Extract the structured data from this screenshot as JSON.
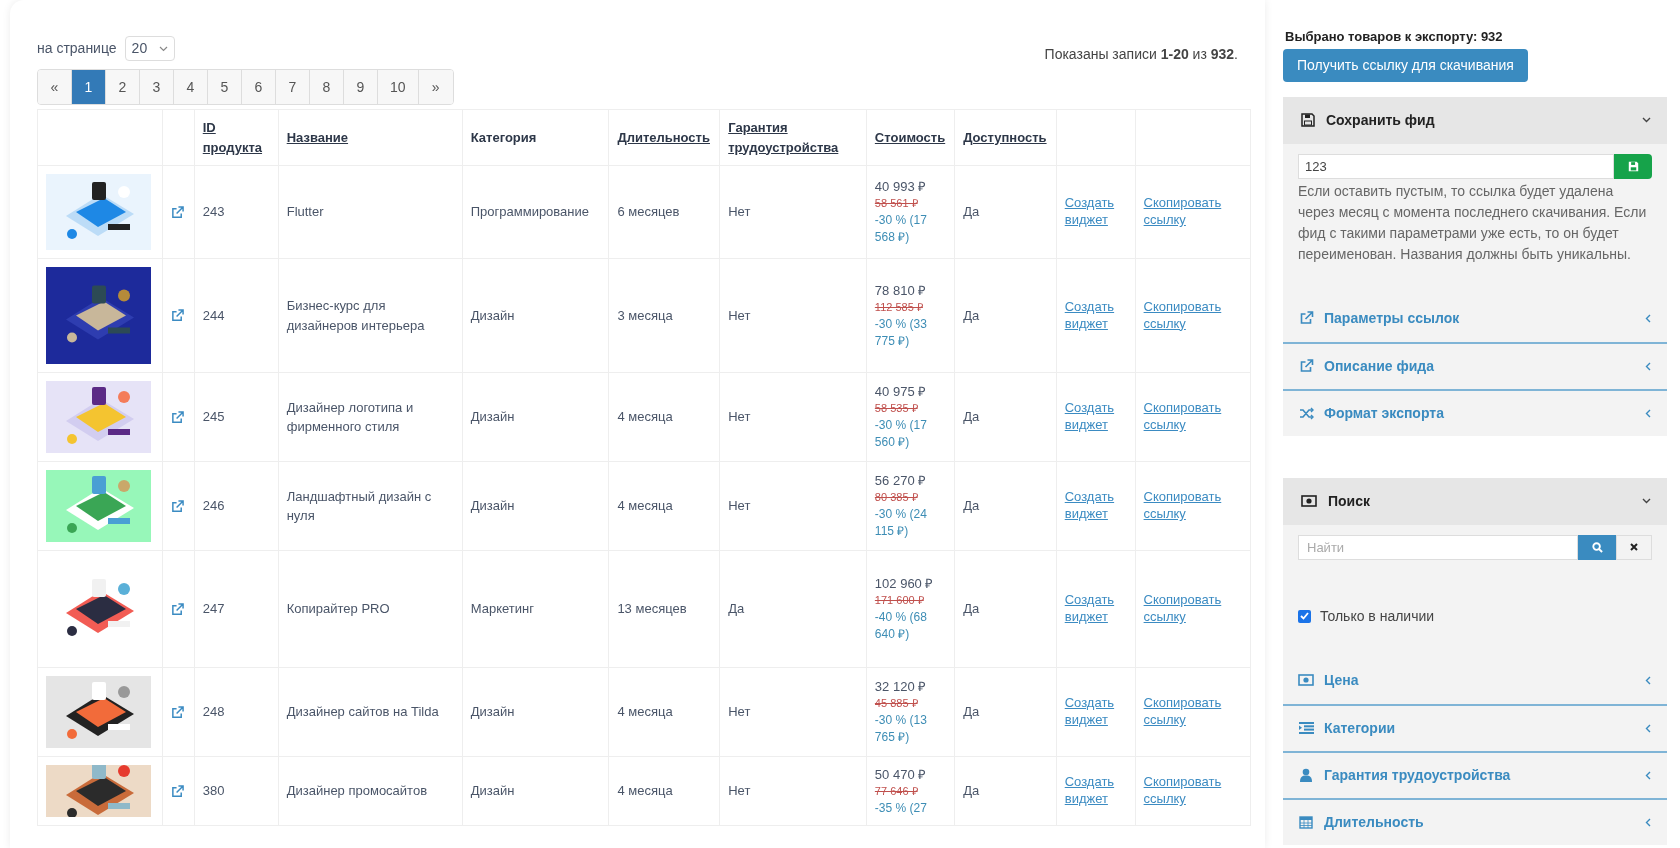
{
  "per_page": {
    "label": "на странице",
    "value": "20"
  },
  "pagination": {
    "prev": "«",
    "next": "»",
    "pages": [
      {
        "label": "1",
        "selected": true
      },
      {
        "label": "2",
        "selected": false
      },
      {
        "label": "3",
        "selected": false
      },
      {
        "label": "4",
        "selected": false
      },
      {
        "label": "5",
        "selected": false
      },
      {
        "label": "6",
        "selected": false
      },
      {
        "label": "7",
        "selected": false
      },
      {
        "label": "8",
        "selected": false
      },
      {
        "label": "9",
        "selected": false
      },
      {
        "label": "10",
        "selected": false
      }
    ]
  },
  "summary": "Показаны записи **1-20** из **932**.",
  "table": {
    "columns": [
      {
        "label": "ID продукта",
        "sortable": true
      },
      {
        "label": "Название",
        "sortable": true
      },
      {
        "label": "Категория",
        "sortable": false
      },
      {
        "label": "Длительность",
        "sortable": true
      },
      {
        "label": "Гарантия трудоустройства",
        "sortable": true
      },
      {
        "label": "Стоимость",
        "sortable": true
      },
      {
        "label": "Доступность",
        "sortable": true
      }
    ],
    "rows": [
      {
        "id": "243",
        "name": "Flutter",
        "category": "Программирование",
        "duration": "6 месяцев",
        "guarantee": "Нет",
        "price": "40 993 ₽",
        "old_price": "58 561 ₽",
        "discount": "-30 % (17 568 ₽)",
        "availability": "Да",
        "widget_link": "Создать виджет",
        "copy_link": "Скопировать ссылку"
      },
      {
        "id": "244",
        "name": "Бизнес-курс для дизайнеров интерьера",
        "category": "Дизайн",
        "duration": "3 месяца",
        "guarantee": "Нет",
        "price": "78 810 ₽",
        "old_price": "112 585 ₽",
        "discount": "-30 % (33 775 ₽)",
        "availability": "Да",
        "widget_link": "Создать виджет",
        "copy_link": "Скопировать ссылку"
      },
      {
        "id": "245",
        "name": "Дизайнер логотипа и фирменного стиля",
        "category": "Дизайн",
        "duration": "4 месяца",
        "guarantee": "Нет",
        "price": "40 975 ₽",
        "old_price": "58 535 ₽",
        "discount": "-30 % (17 560 ₽)",
        "availability": "Да",
        "widget_link": "Создать виджет",
        "copy_link": "Скопировать ссылку"
      },
      {
        "id": "246",
        "name": "Ландшафтный дизайн с нуля",
        "category": "Дизайн",
        "duration": "4 месяца",
        "guarantee": "Нет",
        "price": "56 270 ₽",
        "old_price": "80 385 ₽",
        "discount": "-30 % (24 115 ₽)",
        "availability": "Да",
        "widget_link": "Создать виджет",
        "copy_link": "Скопировать ссылку"
      },
      {
        "id": "247",
        "name": "Копирайтер PRO",
        "category": "Маркетинг",
        "duration": "13 месяцев",
        "guarantee": "Да",
        "price": "102 960 ₽",
        "old_price": "171 600 ₽",
        "discount": "-40 % (68 640 ₽)",
        "availability": "Да",
        "widget_link": "Создать виджет",
        "copy_link": "Скопировать ссылку"
      },
      {
        "id": "248",
        "name": "Дизайнер сайтов на Tilda",
        "category": "Дизайн",
        "duration": "4 месяца",
        "guarantee": "Нет",
        "price": "32 120 ₽",
        "old_price": "45 885 ₽",
        "discount": "-30 % (13 765 ₽)",
        "availability": "Да",
        "widget_link": "Создать виджет",
        "copy_link": "Скопировать ссылку"
      },
      {
        "id": "380",
        "name": "Дизайнер промосайтов",
        "category": "Дизайн",
        "duration": "4 месяца",
        "guarantee": "Нет",
        "price": "50 470 ₽",
        "old_price": "77 646 ₽",
        "discount": "-35 % (27",
        "availability": "Да",
        "widget_link": "Создать виджет",
        "copy_link": "Скопировать ссылку"
      }
    ]
  },
  "export": {
    "selected_label": "Выбрано товаров к экспорту: 932",
    "button": "Получить ссылку для скачивания"
  },
  "panels": [
    {
      "kind": "save",
      "title": "Сохранить фид",
      "expanded": true,
      "input_value": "123",
      "hint": "Если оставить пустым, то ссылка будет удалена через месяц с момента последнего скачивания. Если фид с такими параметрами уже есть, то он будет переименован. Названия должны быть уникальны.",
      "sections": [
        {
          "title": "Параметры ссылок",
          "expanded": false
        },
        {
          "title": "Описание фида",
          "expanded": false
        },
        {
          "title": "Формат экспорта",
          "expanded": false
        }
      ]
    },
    {
      "kind": "search",
      "title": "Поиск",
      "expanded": true,
      "placeholder": "Найти",
      "checkbox": {
        "label": "Только в наличии",
        "checked": true
      },
      "sections": [
        {
          "title": "Цена",
          "expanded": false
        },
        {
          "title": "Категории",
          "expanded": false
        },
        {
          "title": "Гарантия трудоустройства",
          "expanded": false
        },
        {
          "title": "Длительность",
          "expanded": false
        }
      ]
    }
  ]
}
